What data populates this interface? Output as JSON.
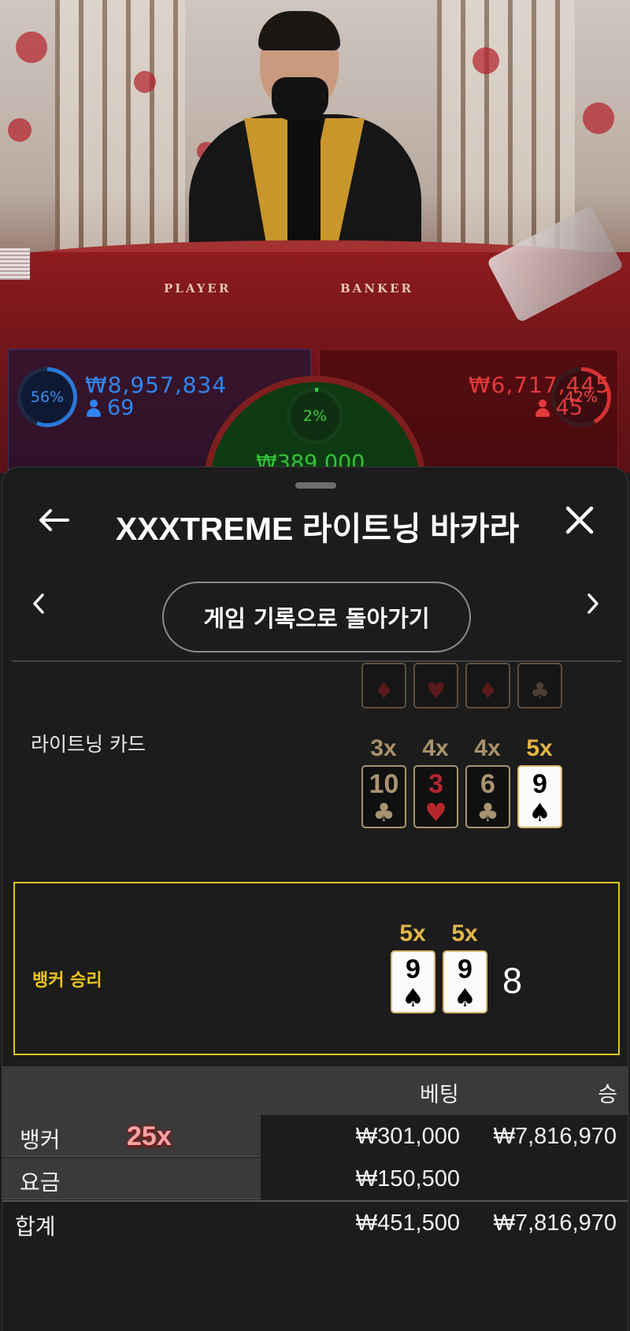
{
  "video": {
    "table_labels": [
      "PLAYER",
      "BANKER"
    ]
  },
  "bets_overview": {
    "player": {
      "percent": "56%",
      "percent_value": 56,
      "amount": "₩8,957,834",
      "count": "69",
      "color": "#2f86ef"
    },
    "banker": {
      "percent": "42%",
      "percent_value": 42,
      "amount": "₩6,717,445",
      "count": "45",
      "color": "#e23a3a"
    },
    "tie": {
      "percent": "2%",
      "percent_value": 2,
      "amount": "₩389,000",
      "color": "#36c23a"
    }
  },
  "sheet": {
    "title": "XXXTREME 라이트닝 바카라",
    "back_icon": "arrow-left-icon",
    "close_icon": "close-icon",
    "nav": {
      "prev_icon": "chevron-left-icon",
      "next_icon": "chevron-right-icon",
      "back_to_history": "게임 기록으로 돌아가기"
    }
  },
  "lightning": {
    "label": "라이트닝 카드",
    "partial_cards": [
      {
        "suit": "♦",
        "color": "red"
      },
      {
        "suit": "♥",
        "color": "red"
      },
      {
        "suit": "♦",
        "color": "red"
      },
      {
        "suit": "♣",
        "color": "black"
      }
    ],
    "cards": [
      {
        "mult": "3x",
        "rank": "10",
        "suit": "♣",
        "color": "black",
        "highlight": false
      },
      {
        "mult": "4x",
        "rank": "3",
        "suit": "♥",
        "color": "red",
        "highlight": false
      },
      {
        "mult": "4x",
        "rank": "6",
        "suit": "♣",
        "color": "black",
        "highlight": false
      },
      {
        "mult": "5x",
        "rank": "9",
        "suit": "♠",
        "color": "black",
        "highlight": true
      }
    ]
  },
  "result": {
    "label": "뱅커 승리",
    "score": "8",
    "accent": "#e1c420",
    "cards": [
      {
        "mult": "5x",
        "rank": "9",
        "suit": "♠"
      },
      {
        "mult": "5x",
        "rank": "9",
        "suit": "♠"
      }
    ]
  },
  "bets_table": {
    "headers": {
      "bet": "베팅",
      "win": "승"
    },
    "rows": [
      {
        "name": "뱅커",
        "multiplier": "25x",
        "bet": "₩301,000",
        "win": "₩7,816,970"
      },
      {
        "name": "요금",
        "multiplier": "",
        "bet": "₩150,500",
        "win": ""
      }
    ],
    "total": {
      "name": "합계",
      "bet": "₩451,500",
      "win": "₩7,816,970"
    }
  }
}
